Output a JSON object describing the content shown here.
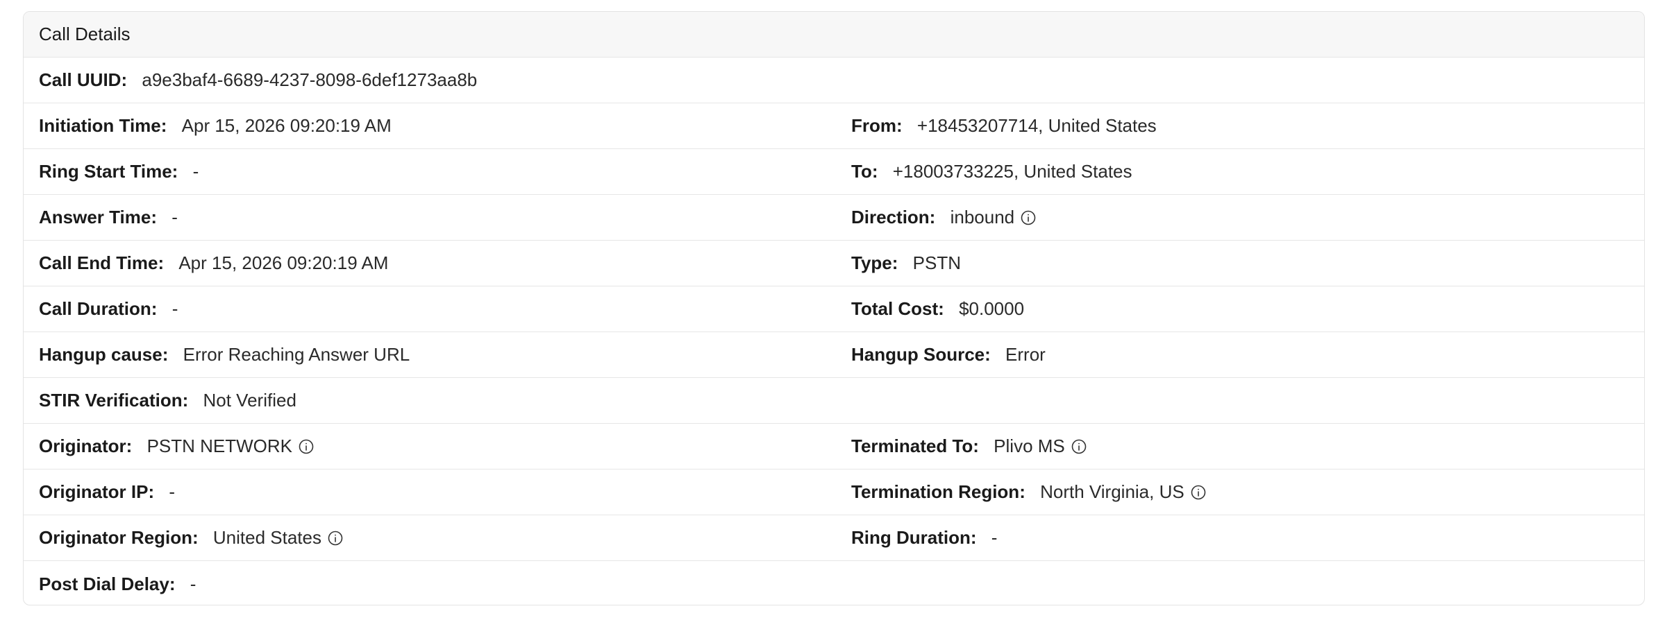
{
  "card": {
    "title": "Call Details"
  },
  "rows": [
    {
      "left": {
        "label": "Call UUID:",
        "value": "a9e3baf4-6689-4237-8098-6def1273aa8b"
      }
    },
    {
      "left": {
        "label": "Initiation Time:",
        "value": "Apr 15, 2026 09:20:19 AM"
      },
      "right": {
        "label": "From:",
        "value": "+18453207714, United States"
      }
    },
    {
      "left": {
        "label": "Ring Start Time:",
        "value": "-"
      },
      "right": {
        "label": "To:",
        "value": "+18003733225, United States"
      }
    },
    {
      "left": {
        "label": "Answer Time:",
        "value": "-"
      },
      "right": {
        "label": "Direction:",
        "value": "inbound",
        "icon": "info-icon"
      }
    },
    {
      "left": {
        "label": "Call End Time:",
        "value": "Apr 15, 2026 09:20:19 AM"
      },
      "right": {
        "label": "Type:",
        "value": "PSTN"
      }
    },
    {
      "left": {
        "label": "Call Duration:",
        "value": "-"
      },
      "right": {
        "label": "Total Cost:",
        "value": "$0.0000"
      }
    },
    {
      "left": {
        "label": "Hangup cause:",
        "value": "Error Reaching Answer URL"
      },
      "right": {
        "label": "Hangup Source:",
        "value": "Error"
      }
    },
    {
      "left": {
        "label": "STIR Verification:",
        "value": "Not Verified"
      }
    },
    {
      "left": {
        "label": "Originator:",
        "value": "PSTN NETWORK",
        "icon": "info-icon"
      },
      "right": {
        "label": "Terminated To:",
        "value": "Plivo MS",
        "icon": "info-icon"
      }
    },
    {
      "left": {
        "label": "Originator IP:",
        "value": "-"
      },
      "right": {
        "label": "Termination Region:",
        "value": "North Virginia, US",
        "icon": "info-icon"
      }
    },
    {
      "left": {
        "label": "Originator Region:",
        "value": "United States",
        "icon": "info-icon"
      },
      "right": {
        "label": "Ring Duration:",
        "value": "-"
      }
    },
    {
      "left": {
        "label": "Post Dial Delay:",
        "value": "-"
      }
    }
  ]
}
